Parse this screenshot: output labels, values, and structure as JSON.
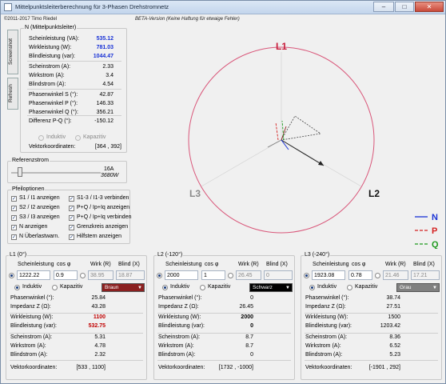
{
  "window": {
    "title": "Mittelpunktsleiterberechnung für 3-Phasen Drehstromnetz",
    "minimize": "–",
    "maximize": "□",
    "close": "✕"
  },
  "copyright": "©2011-2017 Timo Riedel",
  "beta": "BETA-Version (Keine Haftung für etwaige Fehler)",
  "side_tabs": {
    "screenshot": "Screenshot",
    "refresh": "Refresh"
  },
  "n_panel": {
    "title": "N (Mittelpunktsleiter)",
    "rows": [
      {
        "label": "Scheinleistung (VA):",
        "value": "535.12"
      },
      {
        "label": "Wirkleistung (W):",
        "value": "781.03"
      },
      {
        "label": "Blindleistung (var):",
        "value": "1044.47"
      },
      {
        "label": "Scheinstrom (A):",
        "value": "2.33"
      },
      {
        "label": "Wirkstrom (A):",
        "value": "3.4"
      },
      {
        "label": "Blindstrom (A):",
        "value": "4.54"
      },
      {
        "label": "Phasenwinkel S (°):",
        "value": "42.87"
      },
      {
        "label": "Phasenwinkel P (°):",
        "value": "146.33"
      },
      {
        "label": "Phasenwinkel Q (°):",
        "value": "356.21"
      },
      {
        "label": "Differenz P-Q (°):",
        "value": "-150.12"
      }
    ],
    "radio_induktiv": "Induktiv",
    "radio_kapazitiv": "Kapazitiv",
    "vektor_label": "Vektorkoordinaten:",
    "vektor_value": "[364 , 392]"
  },
  "referenz": {
    "title": "Referenzstrom",
    "line1": "16A",
    "line2": "3680W",
    "slider_fraction": 0.08
  },
  "pfeil": {
    "title": "Pfeiloptionen",
    "left": [
      "S1 / I1 anzeigen",
      "S2 / I2 anzeigen",
      "S3 / I3 anzeigen",
      "N anzeigen",
      "N Überlastwarn."
    ],
    "right": [
      "S1-3 / I1-3 verbinden",
      "P+Q / Ip+Iq anzeigen",
      "P+Q / Ip+Iq verbinden",
      "Grenzkreis anzeigen",
      "Hilfstern anzeigen"
    ]
  },
  "diagram": {
    "labels": {
      "l1": "L1",
      "l2": "L2",
      "l3": "L3"
    },
    "legend": [
      {
        "label": "N",
        "color": "#1a33d6"
      },
      {
        "label": "P",
        "color": "#d42020"
      },
      {
        "label": "Q",
        "color": "#1d9a1d"
      }
    ]
  },
  "phases": [
    {
      "title": "L1 (0°)",
      "hdr": {
        "schein": "Scheinleistung",
        "cos": "cos φ",
        "wirk": "Wirk (R)",
        "blind": "Blind (X)"
      },
      "schein": "1222.22",
      "cos": "0.9",
      "wirk": "38.95",
      "blind": "18.87",
      "induktiv": "Induktiv",
      "kapazitiv": "Kapazitiv",
      "color_name": "Braun",
      "color": "#8b2020",
      "rows": [
        {
          "label": "Phasenwinkel (°):",
          "value": "25.84"
        },
        {
          "label": "Impedanz Z (Ω):",
          "value": "43.28"
        },
        {
          "label": "Wirkleistung (W):",
          "value": "1100"
        },
        {
          "label": "Blindleistung (var):",
          "value": "532.75"
        },
        {
          "label": "Scheinstrom (A):",
          "value": "5.31"
        },
        {
          "label": "Wirkstrom (A):",
          "value": "4.78"
        },
        {
          "label": "Blindstrom (A):",
          "value": "2.32"
        }
      ],
      "vektor_label": "Vektorkoordinaten:",
      "vektor_value": "[533 , 1100]"
    },
    {
      "title": "L2 (-120°)",
      "hdr": {
        "schein": "Scheinleistung",
        "cos": "cos φ",
        "wirk": "Wirk (R)",
        "blind": "Blind (X)"
      },
      "schein": "2000",
      "cos": "1",
      "wirk": "26.45",
      "blind": "0",
      "induktiv": "Induktiv",
      "kapazitiv": "Kapazitiv",
      "color_name": "Schwarz",
      "color": "#000000",
      "rows": [
        {
          "label": "Phasenwinkel (°):",
          "value": "0"
        },
        {
          "label": "Impedanz Z (Ω):",
          "value": "26.45"
        },
        {
          "label": "Wirkleistung (W):",
          "value": "2000"
        },
        {
          "label": "Blindleistung (var):",
          "value": "0"
        },
        {
          "label": "Scheinstrom (A):",
          "value": "8.7"
        },
        {
          "label": "Wirkstrom (A):",
          "value": "8.7"
        },
        {
          "label": "Blindstrom (A):",
          "value": "0"
        }
      ],
      "vektor_label": "Vektorkoordinaten:",
      "vektor_value": "[1732 , -1000]"
    },
    {
      "title": "L3 (-240°)",
      "hdr": {
        "schein": "Scheinleistung",
        "cos": "cos φ",
        "wirk": "Wirk (R)",
        "blind": "Blind (X)"
      },
      "schein": "1923.08",
      "cos": "0.78",
      "wirk": "21.46",
      "blind": "17.21",
      "induktiv": "Induktiv",
      "kapazitiv": "Kapazitiv",
      "color_name": "Grau",
      "color": "#808080",
      "rows": [
        {
          "label": "Phasenwinkel (°):",
          "value": "38.74"
        },
        {
          "label": "Impedanz Z (Ω):",
          "value": "27.51"
        },
        {
          "label": "Wirkleistung (W):",
          "value": "1500"
        },
        {
          "label": "Blindleistung (var):",
          "value": "1203.42"
        },
        {
          "label": "Scheinstrom (A):",
          "value": "8.36"
        },
        {
          "label": "Wirkstrom (A):",
          "value": "6.52"
        },
        {
          "label": "Blindstrom (A):",
          "value": "5.23"
        }
      ],
      "vektor_label": "Vektorkoordinaten:",
      "vektor_value": "[-1901 , 292]"
    }
  ]
}
